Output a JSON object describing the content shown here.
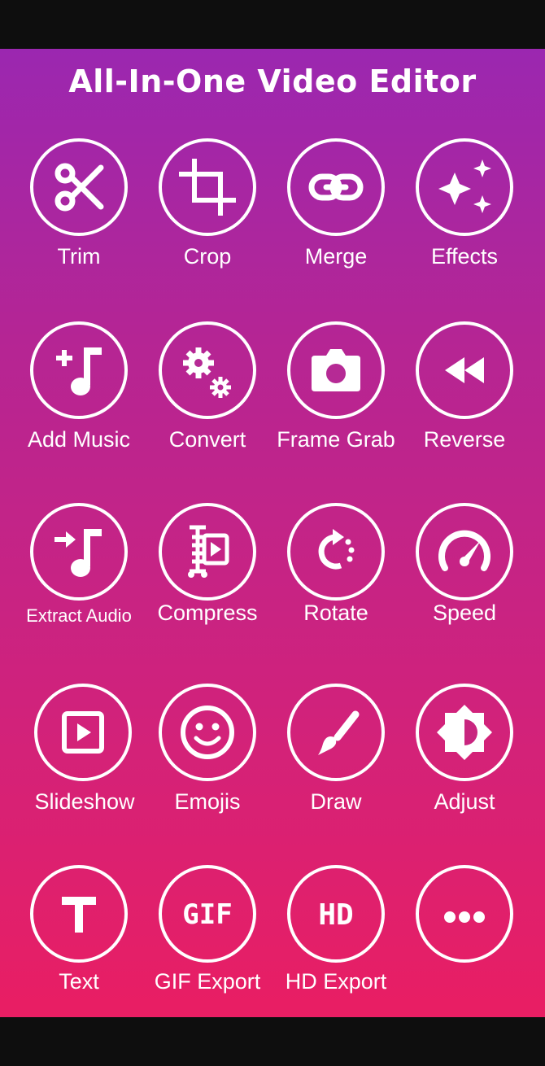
{
  "app": {
    "title": "All-In-One Video Editor"
  },
  "tools": [
    {
      "label": "Trim",
      "icon": "scissors-icon"
    },
    {
      "label": "Crop",
      "icon": "crop-icon"
    },
    {
      "label": "Merge",
      "icon": "link-icon"
    },
    {
      "label": "Effects",
      "icon": "sparkles-icon"
    },
    {
      "label": "Add Music",
      "icon": "music-add-icon"
    },
    {
      "label": "Convert",
      "icon": "gears-icon"
    },
    {
      "label": "Frame Grab",
      "icon": "camera-icon"
    },
    {
      "label": "Reverse",
      "icon": "rewind-icon"
    },
    {
      "label": "Extract Audio",
      "icon": "music-extract-icon"
    },
    {
      "label": "Compress",
      "icon": "compress-icon"
    },
    {
      "label": "Rotate",
      "icon": "rotate-icon"
    },
    {
      "label": "Speed",
      "icon": "speedometer-icon"
    },
    {
      "label": "Slideshow",
      "icon": "slideshow-icon"
    },
    {
      "label": "Emojis",
      "icon": "smiley-icon"
    },
    {
      "label": "Draw",
      "icon": "brush-icon"
    },
    {
      "label": "Adjust",
      "icon": "brightness-icon"
    },
    {
      "label": "Text",
      "icon": "text-icon"
    },
    {
      "label": "GIF Export",
      "icon": "gif-icon"
    },
    {
      "label": "HD Export",
      "icon": "hd-icon"
    },
    {
      "label": "",
      "icon": "more-icon"
    }
  ]
}
